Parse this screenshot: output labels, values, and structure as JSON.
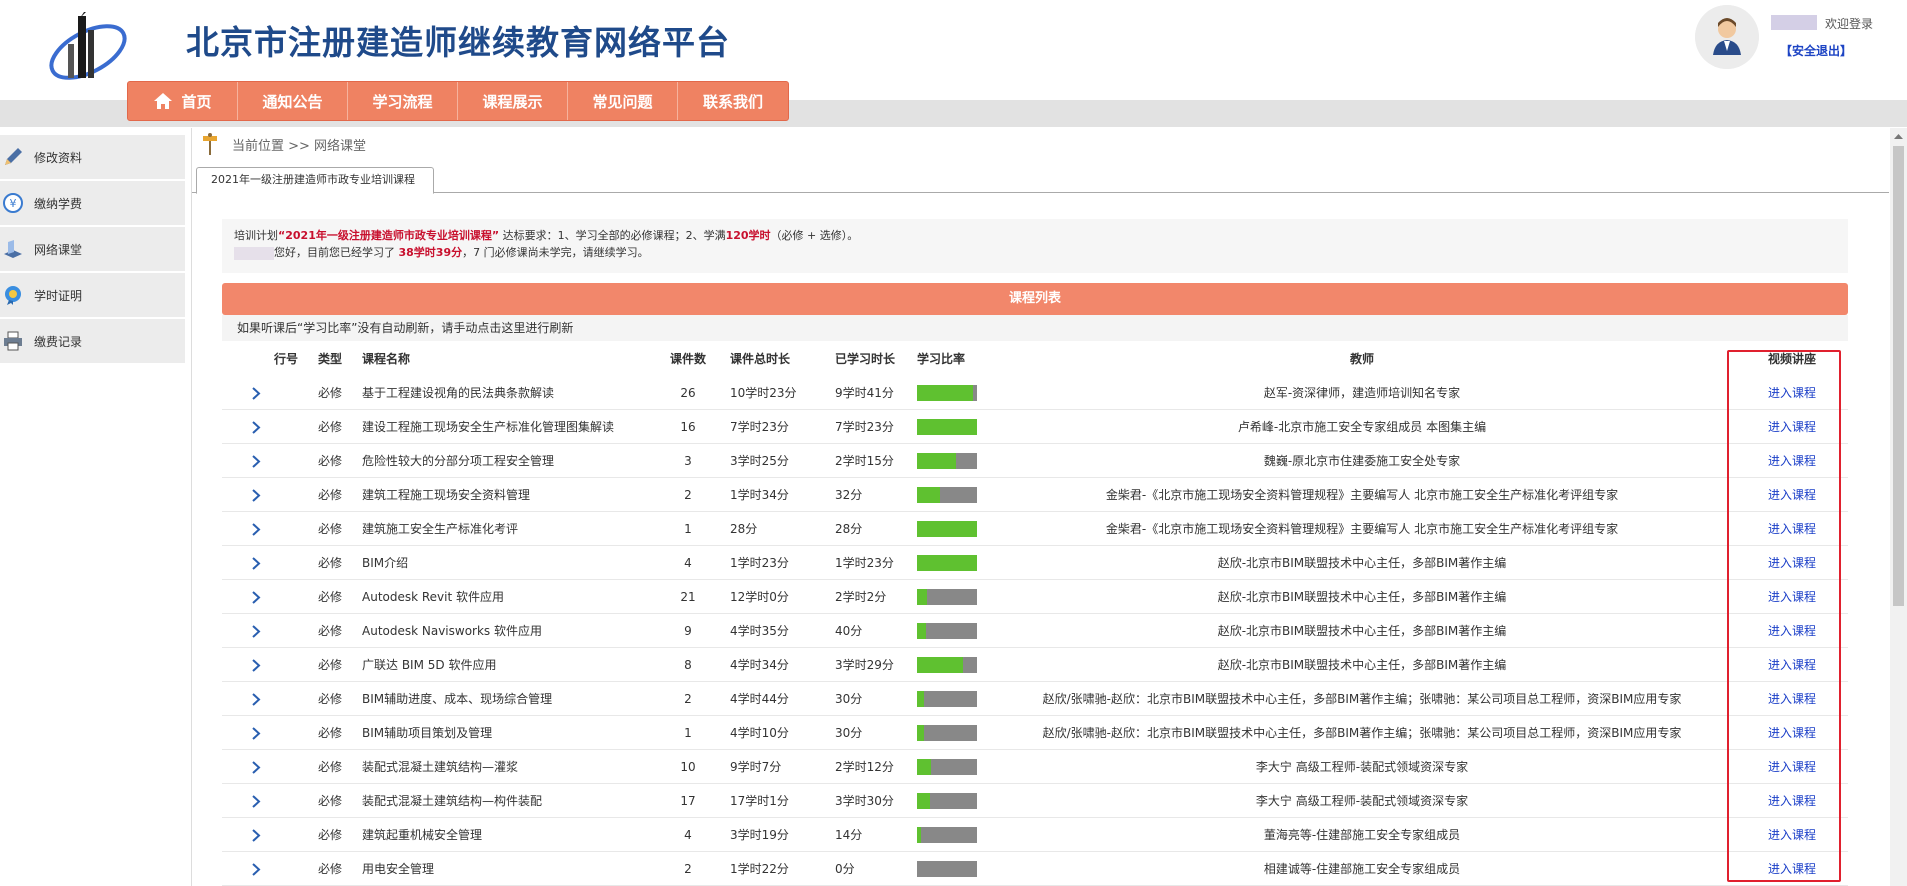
{
  "site": {
    "title": "北京市注册建造师继续教育网络平台"
  },
  "user": {
    "welcome": "欢迎登录",
    "logout": "【安全退出】"
  },
  "nav": [
    {
      "label": "首页",
      "icon": "home-icon"
    },
    {
      "label": "通知公告"
    },
    {
      "label": "学习流程"
    },
    {
      "label": "课程展示"
    },
    {
      "label": "常见问题"
    },
    {
      "label": "联系我们"
    }
  ],
  "sidebar": [
    {
      "label": "修改资料",
      "icon": "pencil-icon"
    },
    {
      "label": "缴纳学费",
      "icon": "yen-coin-icon"
    },
    {
      "label": "网络课堂",
      "icon": "book-icon"
    },
    {
      "label": "学时证明",
      "icon": "certificate-badge-icon"
    },
    {
      "label": "缴费记录",
      "icon": "printer-icon"
    }
  ],
  "breadcrumb": "当前位置 >> 网络课堂",
  "tab": "2021年一级注册建造师市政专业培训课程",
  "notice": {
    "p1": "培训计划",
    "plan": "“2021年一级注册建造师市政专业培训课程”",
    "p2": "达标要求：1、学习全部的必修课程；2、学满",
    "hours": "120学时",
    "p3": "（必修 + 选修）。",
    "p4": "您好，目前您已经学习了",
    "studied": "38学时39分",
    "p5": "，7 门必修课尚未学完，请继续学习。"
  },
  "list_title": "课程列表",
  "refresh_tip": "如果听课后“学习比率”没有自动刷新，请手动点击这里进行刷新",
  "columns": {
    "idx": "行号",
    "type": "类型",
    "name": "课程名称",
    "count": "课件数",
    "total": "课件总时长",
    "done": "已学习时长",
    "rate": "学习比率",
    "teacher": "教师",
    "video": "视频讲座"
  },
  "colors": {
    "brand": "#1f4a8a",
    "nav": "#ef8262",
    "progress": "#5fc130",
    "link": "#1a3ec8",
    "highlight": "#e0202e"
  },
  "rows": [
    {
      "type": "必修",
      "name": "基于工程建设视角的民法典条款解读",
      "count": "26",
      "total": "10学时23分",
      "done": "9学时41分",
      "progress": 0.93,
      "teacher": "赵军-资深律师，建造师培训知名专家",
      "link": "进入课程"
    },
    {
      "type": "必修",
      "name": "建设工程施工现场安全生产标准化管理图集解读",
      "count": "16",
      "total": "7学时23分",
      "done": "7学时23分",
      "progress": 1.0,
      "teacher": "卢希峰-北京市施工安全专家组成员 本图集主编",
      "link": "进入课程"
    },
    {
      "type": "必修",
      "name": "危险性较大的分部分项工程安全管理",
      "count": "3",
      "total": "3学时25分",
      "done": "2学时15分",
      "progress": 0.65,
      "teacher": "魏巍-原北京市住建委施工安全处专家",
      "link": "进入课程"
    },
    {
      "type": "必修",
      "name": "建筑工程施工现场安全资料管理",
      "count": "2",
      "total": "1学时34分",
      "done": " 32分",
      "progress": 0.38,
      "teacher": "金柴君-《北京市施工现场安全资料管理规程》主要编写人 北京市施工安全生产标准化考评组专家",
      "link": "进入课程"
    },
    {
      "type": "必修",
      "name": "建筑施工安全生产标准化考评",
      "count": "1",
      "total": " 28分",
      "done": " 28分",
      "progress": 1.0,
      "teacher": "金柴君-《北京市施工现场安全资料管理规程》主要编写人 北京市施工安全生产标准化考评组专家",
      "link": "进入课程"
    },
    {
      "type": "必修",
      "name": "BIM介绍",
      "count": "4",
      "total": "1学时23分",
      "done": "1学时23分",
      "progress": 1.0,
      "teacher": "赵欣-北京市BIM联盟技术中心主任，多部BIM著作主编",
      "link": "进入课程"
    },
    {
      "type": "必修",
      "name": "Autodesk Revit 软件应用",
      "count": "21",
      "total": "12学时0分",
      "done": "2学时2分",
      "progress": 0.17,
      "teacher": "赵欣-北京市BIM联盟技术中心主任，多部BIM著作主编",
      "link": "进入课程"
    },
    {
      "type": "必修",
      "name": "Autodesk Navisworks 软件应用",
      "count": "9",
      "total": "4学时35分",
      "done": " 40分",
      "progress": 0.15,
      "teacher": "赵欣-北京市BIM联盟技术中心主任，多部BIM著作主编",
      "link": "进入课程"
    },
    {
      "type": "必修",
      "name": "广联达 BIM 5D 软件应用",
      "count": "8",
      "total": "4学时34分",
      "done": "3学时29分",
      "progress": 0.77,
      "teacher": "赵欣-北京市BIM联盟技术中心主任，多部BIM著作主编",
      "link": "进入课程"
    },
    {
      "type": "必修",
      "name": "BIM辅助进度、成本、现场综合管理",
      "count": "2",
      "total": "4学时44分",
      "done": " 30分",
      "progress": 0.11,
      "teacher": "赵欣/张啸驰-赵欣：北京市BIM联盟技术中心主任，多部BIM著作主编；张啸驰：某公司项目总工程师，资深BIM应用专家",
      "link": "进入课程"
    },
    {
      "type": "必修",
      "name": "BIM辅助项目策划及管理",
      "count": "1",
      "total": "4学时10分",
      "done": " 30分",
      "progress": 0.12,
      "teacher": "赵欣/张啸驰-赵欣：北京市BIM联盟技术中心主任，多部BIM著作主编；张啸驰：某公司项目总工程师，资深BIM应用专家",
      "link": "进入课程"
    },
    {
      "type": "必修",
      "name": "装配式混凝土建筑结构—灌浆",
      "count": "10",
      "total": "9学时7分",
      "done": "2学时12分",
      "progress": 0.24,
      "teacher": "李大宁 高级工程师-装配式领域资深专家",
      "link": "进入课程"
    },
    {
      "type": "必修",
      "name": "装配式混凝土建筑结构—构件装配",
      "count": "17",
      "total": "17学时1分",
      "done": "3学时30分",
      "progress": 0.21,
      "teacher": "李大宁 高级工程师-装配式领域资深专家",
      "link": "进入课程"
    },
    {
      "type": "必修",
      "name": "建筑起重机械安全管理",
      "count": "4",
      "total": "3学时19分",
      "done": " 14分",
      "progress": 0.07,
      "teacher": "董海亮等-住建部施工安全专家组成员",
      "link": "进入课程"
    },
    {
      "type": "必修",
      "name": "用电安全管理",
      "count": "2",
      "total": "1学时22分",
      "done": " 0分",
      "progress": 0.0,
      "teacher": "相建诚等-住建部施工安全专家组成员",
      "link": "进入课程"
    }
  ]
}
